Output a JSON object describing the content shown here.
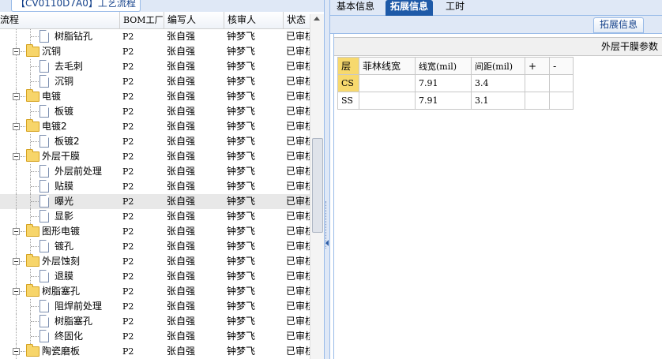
{
  "left": {
    "tab_title": "【CV0110D7A0】工艺流程",
    "columns": [
      "流程",
      "BOM工厂",
      "编写人",
      "核审人",
      "状态"
    ],
    "rows": [
      {
        "name": "树脂钻孔",
        "type": "leaf",
        "factory": "P2",
        "writer": "张自强",
        "auditor": "钟梦飞",
        "status": "已审核"
      },
      {
        "name": "沉铜",
        "type": "folder",
        "factory": "P2",
        "writer": "张自强",
        "auditor": "钟梦飞",
        "status": "已审核"
      },
      {
        "name": "去毛刺",
        "type": "leaf",
        "factory": "P2",
        "writer": "张自强",
        "auditor": "钟梦飞",
        "status": "已审核"
      },
      {
        "name": "沉铜",
        "type": "leaf",
        "factory": "P2",
        "writer": "张自强",
        "auditor": "钟梦飞",
        "status": "已审核"
      },
      {
        "name": "电镀",
        "type": "folder",
        "factory": "P2",
        "writer": "张自强",
        "auditor": "钟梦飞",
        "status": "已审核"
      },
      {
        "name": "板镀",
        "type": "leaf",
        "factory": "P2",
        "writer": "张自强",
        "auditor": "钟梦飞",
        "status": "已审核"
      },
      {
        "name": "电镀2",
        "type": "folder",
        "factory": "P2",
        "writer": "张自强",
        "auditor": "钟梦飞",
        "status": "已审核"
      },
      {
        "name": "板镀2",
        "type": "leaf",
        "factory": "P2",
        "writer": "张自强",
        "auditor": "钟梦飞",
        "status": "已审核"
      },
      {
        "name": "外层干膜",
        "type": "folder",
        "factory": "P2",
        "writer": "张自强",
        "auditor": "钟梦飞",
        "status": "已审核"
      },
      {
        "name": "外层前处理",
        "type": "leaf",
        "factory": "P2",
        "writer": "张自强",
        "auditor": "钟梦飞",
        "status": "已审核"
      },
      {
        "name": "贴膜",
        "type": "leaf",
        "factory": "P2",
        "writer": "张自强",
        "auditor": "钟梦飞",
        "status": "已审核"
      },
      {
        "name": "曝光",
        "type": "leaf",
        "factory": "P2",
        "writer": "张自强",
        "auditor": "钟梦飞",
        "status": "已审核",
        "selected": true
      },
      {
        "name": "显影",
        "type": "leaf",
        "factory": "P2",
        "writer": "张自强",
        "auditor": "钟梦飞",
        "status": "已审核"
      },
      {
        "name": "图形电镀",
        "type": "folder",
        "factory": "P2",
        "writer": "张自强",
        "auditor": "钟梦飞",
        "status": "已审核"
      },
      {
        "name": "镀孔",
        "type": "leaf",
        "factory": "P2",
        "writer": "张自强",
        "auditor": "钟梦飞",
        "status": "已审核"
      },
      {
        "name": "外层蚀刻",
        "type": "folder",
        "factory": "P2",
        "writer": "张自强",
        "auditor": "钟梦飞",
        "status": "已审核"
      },
      {
        "name": "退膜",
        "type": "leaf",
        "factory": "P2",
        "writer": "张自强",
        "auditor": "钟梦飞",
        "status": "已审核"
      },
      {
        "name": "树脂塞孔",
        "type": "folder",
        "factory": "P2",
        "writer": "张自强",
        "auditor": "钟梦飞",
        "status": "已审核"
      },
      {
        "name": "阻焊前处理",
        "type": "leaf",
        "factory": "P2",
        "writer": "张自强",
        "auditor": "钟梦飞",
        "status": "已审核"
      },
      {
        "name": "树脂塞孔",
        "type": "leaf",
        "factory": "P2",
        "writer": "张自强",
        "auditor": "钟梦飞",
        "status": "已审核"
      },
      {
        "name": "终固化",
        "type": "leaf",
        "factory": "P2",
        "writer": "张自强",
        "auditor": "钟梦飞",
        "status": "已审核"
      },
      {
        "name": "陶瓷磨板",
        "type": "folder",
        "factory": "P2",
        "writer": "张自强",
        "auditor": "钟梦飞",
        "status": "已审核"
      }
    ]
  },
  "right": {
    "tabs": [
      "基本信息",
      "拓展信息",
      "工时"
    ],
    "active_tab": 1,
    "subtab_label": "拓展信息",
    "panel_title": "外层干膜参数",
    "grid": {
      "headers": [
        "层",
        "菲林线宽",
        "线宽(mil)",
        "间距(mil)",
        "+",
        "-"
      ],
      "rows": [
        [
          "CS",
          "",
          "7.91",
          "3.4",
          "",
          ""
        ],
        [
          "SS",
          "",
          "7.91",
          "3.1",
          "",
          ""
        ]
      ]
    }
  },
  "colors": {
    "accent_tab": "#1e5aa8",
    "frame_bg": "#dfe8f6",
    "layer_highlight": "#f7d96e",
    "folder_yellow": "#f7d56a"
  }
}
